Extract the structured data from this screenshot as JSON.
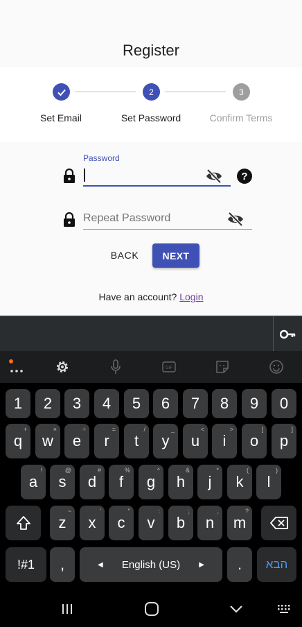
{
  "page": {
    "title": "Register"
  },
  "stepper": {
    "steps": [
      {
        "number": "",
        "label": "Set Email",
        "state": "completed"
      },
      {
        "number": "2",
        "label": "Set Password",
        "state": "active"
      },
      {
        "number": "3",
        "label": "Confirm Terms",
        "state": "inactive"
      }
    ]
  },
  "form": {
    "password": {
      "label": "Password",
      "value": ""
    },
    "repeat": {
      "placeholder": "Repeat Password",
      "value": ""
    },
    "help_icon": "?",
    "back_label": "BACK",
    "next_label": "NEXT"
  },
  "footer": {
    "text": "Have an account?",
    "link": "Login"
  },
  "keyboard": {
    "numbers": [
      "1",
      "2",
      "3",
      "4",
      "5",
      "6",
      "7",
      "8",
      "9",
      "0"
    ],
    "row1": [
      {
        "k": "q",
        "a": "+"
      },
      {
        "k": "w",
        "a": "×"
      },
      {
        "k": "e",
        "a": "÷"
      },
      {
        "k": "r",
        "a": "="
      },
      {
        "k": "t",
        "a": "/"
      },
      {
        "k": "y",
        "a": "_"
      },
      {
        "k": "u",
        "a": "<"
      },
      {
        "k": "i",
        "a": ">"
      },
      {
        "k": "o",
        "a": "["
      },
      {
        "k": "p",
        "a": "]"
      }
    ],
    "row2": [
      {
        "k": "a",
        "a": "!"
      },
      {
        "k": "s",
        "a": "@"
      },
      {
        "k": "d",
        "a": "#"
      },
      {
        "k": "f",
        "a": "%"
      },
      {
        "k": "g",
        "a": "^"
      },
      {
        "k": "h",
        "a": "&"
      },
      {
        "k": "j",
        "a": "*"
      },
      {
        "k": "k",
        "a": "("
      },
      {
        "k": "l",
        "a": ")"
      }
    ],
    "row3": [
      {
        "k": "z",
        "a": "~"
      },
      {
        "k": "x",
        "a": "'"
      },
      {
        "k": "c",
        "a": "\""
      },
      {
        "k": "v",
        "a": ":"
      },
      {
        "k": "b",
        "a": ";"
      },
      {
        "k": "n",
        "a": ","
      },
      {
        "k": "m",
        "a": "?"
      }
    ],
    "symbols_label": "!#1",
    "comma": ",",
    "space_label": "English (US)",
    "period": ".",
    "enter_label": "הבא"
  },
  "colors": {
    "primary": "#3f51b5",
    "link": "#6a3fa0",
    "enter_text": "#4a9cf0"
  }
}
